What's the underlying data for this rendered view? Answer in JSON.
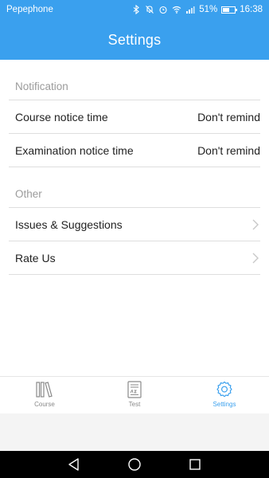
{
  "status_bar": {
    "carrier": "Pepephone",
    "battery_percent": "51%",
    "time": "16:38",
    "icons": [
      "bluetooth-icon",
      "mute-icon",
      "alarm-icon",
      "wifi-icon",
      "signal-icon",
      "battery-icon"
    ]
  },
  "header": {
    "title": "Settings",
    "color": "#3aa0ee"
  },
  "sections": {
    "notification": {
      "label": "Notification",
      "items": [
        {
          "label": "Course notice time",
          "value": "Don't remind"
        },
        {
          "label": "Examination notice time",
          "value": "Don't remind"
        }
      ]
    },
    "other": {
      "label": "Other",
      "items": [
        {
          "label": "Issues & Suggestions",
          "icon": "chevron-right-icon"
        },
        {
          "label": "Rate Us",
          "icon": "chevron-right-icon"
        }
      ]
    }
  },
  "tabbar": {
    "tabs": [
      {
        "label": "Course",
        "icon": "books-icon",
        "active": false
      },
      {
        "label": "Test",
        "icon": "test-sheet-icon",
        "active": false
      },
      {
        "label": "Settings",
        "icon": "gear-icon",
        "active": true
      }
    ],
    "active_color": "#3aa0ee"
  },
  "navbar": {
    "icons": [
      "back-icon",
      "home-icon",
      "recents-icon"
    ]
  }
}
